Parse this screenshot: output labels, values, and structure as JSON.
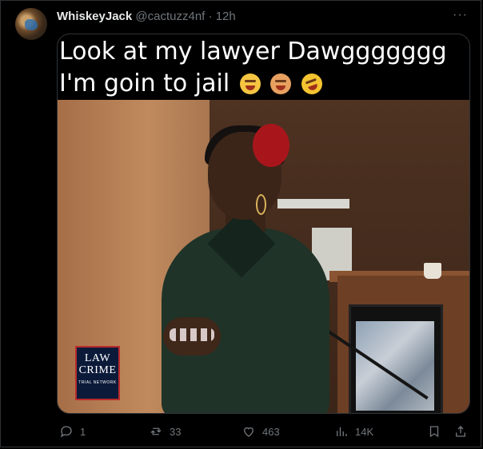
{
  "tweet": {
    "display_name": "WhiskeyJack",
    "handle": "@cactuzz4nf",
    "separator": "·",
    "time": "12h",
    "more": "···",
    "caption": "Look at my lawyer Dawggggggg I'm goin to jail",
    "caption_emojis": [
      "tired-face-emoji",
      "exploding-head-emoji",
      "rolling-laughing-emoji"
    ]
  },
  "media": {
    "logo_line1": "LAW",
    "logo_amp": "&",
    "logo_line2": "CRIME",
    "logo_line3": "TRIAL NETWORK"
  },
  "actions": {
    "replies": "1",
    "reposts": "33",
    "likes": "463",
    "views": "14K"
  },
  "colors": {
    "background": "#000000",
    "text": "#e7e9ea",
    "muted": "#71767b",
    "border": "#2f3336"
  }
}
